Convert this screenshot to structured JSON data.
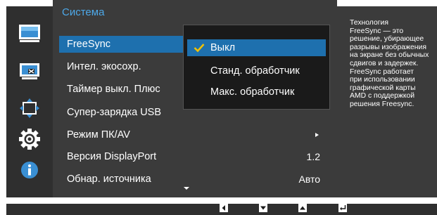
{
  "menu": {
    "title": "Система",
    "items": [
      {
        "label": "FreeSync",
        "value": ""
      },
      {
        "label": "Интел. экосохр.",
        "value": ""
      },
      {
        "label": "Таймер выкл. Плюс",
        "value": ""
      },
      {
        "label": "Супер-зарядка USB",
        "value": ""
      },
      {
        "label": "Режим ПК/AV",
        "value": ""
      },
      {
        "label": "Версия DisplayPort",
        "value": "1.2"
      },
      {
        "label": "Обнар. источника",
        "value": "Авто"
      }
    ]
  },
  "submenu": {
    "options": [
      {
        "label": "Выкл",
        "checked": true
      },
      {
        "label": "Станд. обработчик",
        "checked": false
      },
      {
        "label": "Макс. обработчик",
        "checked": false
      }
    ]
  },
  "description": {
    "text": "Технология\nFreeSync — это\nрешение, убирающее\nразрывы изображения\nна экране без обычных\nсдвигов и задержек.\nFreeSync работает\nпри использовании\nграфической карты\nAMD с поддержкой\nрешения Freesync."
  },
  "nav_icons": [
    "picture-icon",
    "screen-adjust-icon",
    "position-icon",
    "system-gear-icon",
    "information-icon"
  ],
  "controls": [
    "left-arrow-icon",
    "down-arrow-icon",
    "up-arrow-icon",
    "enter-icon"
  ],
  "colors": {
    "accent": "#1e70ae",
    "title": "#4da8e8",
    "panel": "#3b3b3b",
    "icon_bar": "#2f2f2f",
    "submenu": "#1a1a1a"
  }
}
